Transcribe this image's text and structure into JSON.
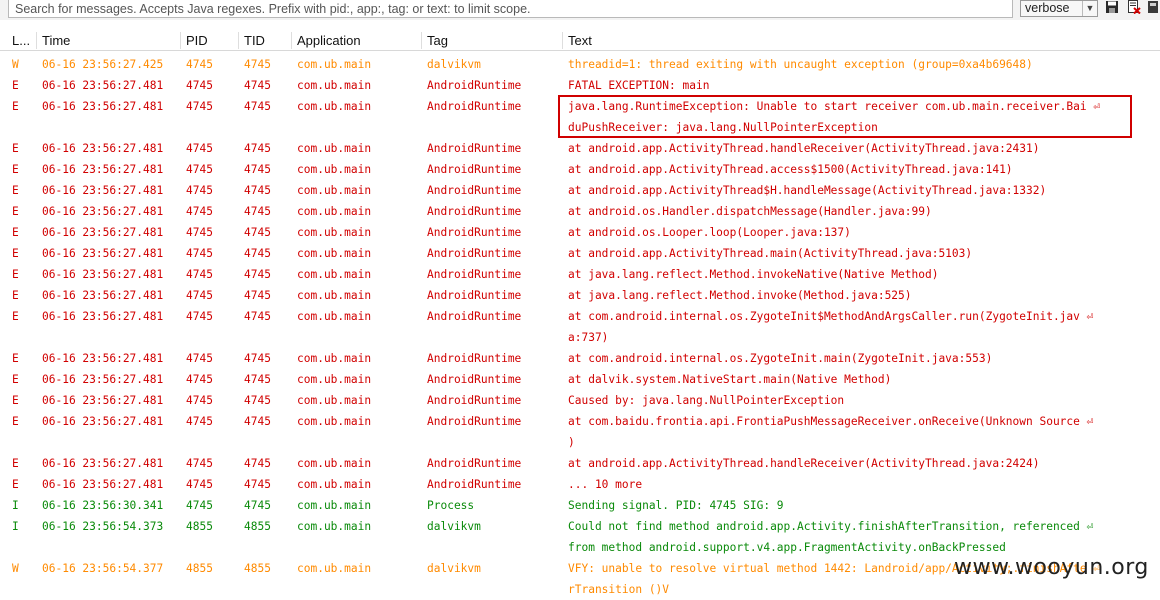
{
  "toolbar": {
    "search_placeholder": "Search for messages. Accepts Java regexes. Prefix with pid:, app:, tag: or text: to limit scope.",
    "log_level": "verbose",
    "icons": [
      "save-icon",
      "clear-log-icon",
      "scroll-lock-icon"
    ]
  },
  "columns": {
    "level": "L...",
    "time": "Time",
    "pid": "PID",
    "tid": "TID",
    "application": "Application",
    "tag": "Tag",
    "text": "Text"
  },
  "colors": {
    "error": "#d10000",
    "warning": "#ff8a00",
    "info": "#0a8a0a",
    "highlight": "#d00000"
  },
  "rows": [
    {
      "level": "W",
      "time": "06-16 23:56:27.425",
      "pid": "4745",
      "tid": "4745",
      "app": "com.ub.main",
      "tag": "dalvikvm",
      "text": [
        "threadid=1: thread exiting with uncaught exception (group=0xa4b69648)"
      ]
    },
    {
      "level": "E",
      "time": "06-16 23:56:27.481",
      "pid": "4745",
      "tid": "4745",
      "app": "com.ub.main",
      "tag": "AndroidRuntime",
      "text": [
        "FATAL EXCEPTION: main"
      ]
    },
    {
      "level": "E",
      "time": "06-16 23:56:27.481",
      "pid": "4745",
      "tid": "4745",
      "app": "com.ub.main",
      "tag": "AndroidRuntime",
      "text": [
        "java.lang.RuntimeException: Unable to start receiver com.ub.main.receiver.Bai ⏎",
        "duPushReceiver: java.lang.NullPointerException"
      ]
    },
    {
      "level": "E",
      "time": "06-16 23:56:27.481",
      "pid": "4745",
      "tid": "4745",
      "app": "com.ub.main",
      "tag": "AndroidRuntime",
      "text": [
        "at android.app.ActivityThread.handleReceiver(ActivityThread.java:2431)"
      ]
    },
    {
      "level": "E",
      "time": "06-16 23:56:27.481",
      "pid": "4745",
      "tid": "4745",
      "app": "com.ub.main",
      "tag": "AndroidRuntime",
      "text": [
        "at android.app.ActivityThread.access$1500(ActivityThread.java:141)"
      ]
    },
    {
      "level": "E",
      "time": "06-16 23:56:27.481",
      "pid": "4745",
      "tid": "4745",
      "app": "com.ub.main",
      "tag": "AndroidRuntime",
      "text": [
        "at android.app.ActivityThread$H.handleMessage(ActivityThread.java:1332)"
      ]
    },
    {
      "level": "E",
      "time": "06-16 23:56:27.481",
      "pid": "4745",
      "tid": "4745",
      "app": "com.ub.main",
      "tag": "AndroidRuntime",
      "text": [
        "at android.os.Handler.dispatchMessage(Handler.java:99)"
      ]
    },
    {
      "level": "E",
      "time": "06-16 23:56:27.481",
      "pid": "4745",
      "tid": "4745",
      "app": "com.ub.main",
      "tag": "AndroidRuntime",
      "text": [
        "at android.os.Looper.loop(Looper.java:137)"
      ]
    },
    {
      "level": "E",
      "time": "06-16 23:56:27.481",
      "pid": "4745",
      "tid": "4745",
      "app": "com.ub.main",
      "tag": "AndroidRuntime",
      "text": [
        "at android.app.ActivityThread.main(ActivityThread.java:5103)"
      ]
    },
    {
      "level": "E",
      "time": "06-16 23:56:27.481",
      "pid": "4745",
      "tid": "4745",
      "app": "com.ub.main",
      "tag": "AndroidRuntime",
      "text": [
        "at java.lang.reflect.Method.invokeNative(Native Method)"
      ]
    },
    {
      "level": "E",
      "time": "06-16 23:56:27.481",
      "pid": "4745",
      "tid": "4745",
      "app": "com.ub.main",
      "tag": "AndroidRuntime",
      "text": [
        "at java.lang.reflect.Method.invoke(Method.java:525)"
      ]
    },
    {
      "level": "E",
      "time": "06-16 23:56:27.481",
      "pid": "4745",
      "tid": "4745",
      "app": "com.ub.main",
      "tag": "AndroidRuntime",
      "text": [
        "at com.android.internal.os.ZygoteInit$MethodAndArgsCaller.run(ZygoteInit.jav ⏎",
        "a:737)"
      ]
    },
    {
      "level": "E",
      "time": "06-16 23:56:27.481",
      "pid": "4745",
      "tid": "4745",
      "app": "com.ub.main",
      "tag": "AndroidRuntime",
      "text": [
        "at com.android.internal.os.ZygoteInit.main(ZygoteInit.java:553)"
      ]
    },
    {
      "level": "E",
      "time": "06-16 23:56:27.481",
      "pid": "4745",
      "tid": "4745",
      "app": "com.ub.main",
      "tag": "AndroidRuntime",
      "text": [
        "at dalvik.system.NativeStart.main(Native Method)"
      ]
    },
    {
      "level": "E",
      "time": "06-16 23:56:27.481",
      "pid": "4745",
      "tid": "4745",
      "app": "com.ub.main",
      "tag": "AndroidRuntime",
      "text": [
        "Caused by: java.lang.NullPointerException"
      ]
    },
    {
      "level": "E",
      "time": "06-16 23:56:27.481",
      "pid": "4745",
      "tid": "4745",
      "app": "com.ub.main",
      "tag": "AndroidRuntime",
      "text": [
        "at com.baidu.frontia.api.FrontiaPushMessageReceiver.onReceive(Unknown Source ⏎",
        ")"
      ]
    },
    {
      "level": "E",
      "time": "06-16 23:56:27.481",
      "pid": "4745",
      "tid": "4745",
      "app": "com.ub.main",
      "tag": "AndroidRuntime",
      "text": [
        "at android.app.ActivityThread.handleReceiver(ActivityThread.java:2424)"
      ]
    },
    {
      "level": "E",
      "time": "06-16 23:56:27.481",
      "pid": "4745",
      "tid": "4745",
      "app": "com.ub.main",
      "tag": "AndroidRuntime",
      "text": [
        "... 10 more"
      ]
    },
    {
      "level": "I",
      "time": "06-16 23:56:30.341",
      "pid": "4745",
      "tid": "4745",
      "app": "com.ub.main",
      "tag": "Process",
      "text": [
        "Sending signal. PID: 4745 SIG: 9"
      ]
    },
    {
      "level": "I",
      "time": "06-16 23:56:54.373",
      "pid": "4855",
      "tid": "4855",
      "app": "com.ub.main",
      "tag": "dalvikvm",
      "text": [
        "Could not find method android.app.Activity.finishAfterTransition, referenced  ⏎",
        "from method android.support.v4.app.FragmentActivity.onBackPressed"
      ]
    },
    {
      "level": "W",
      "time": "06-16 23:56:54.377",
      "pid": "4855",
      "tid": "4855",
      "app": "com.ub.main",
      "tag": "dalvikvm",
      "text": [
        "VFY: unable to resolve virtual method 1442: Landroid/app/Activity;.finishAfte ⏎",
        "rTransition ()V"
      ]
    }
  ],
  "watermark": "www.wooyun.org"
}
